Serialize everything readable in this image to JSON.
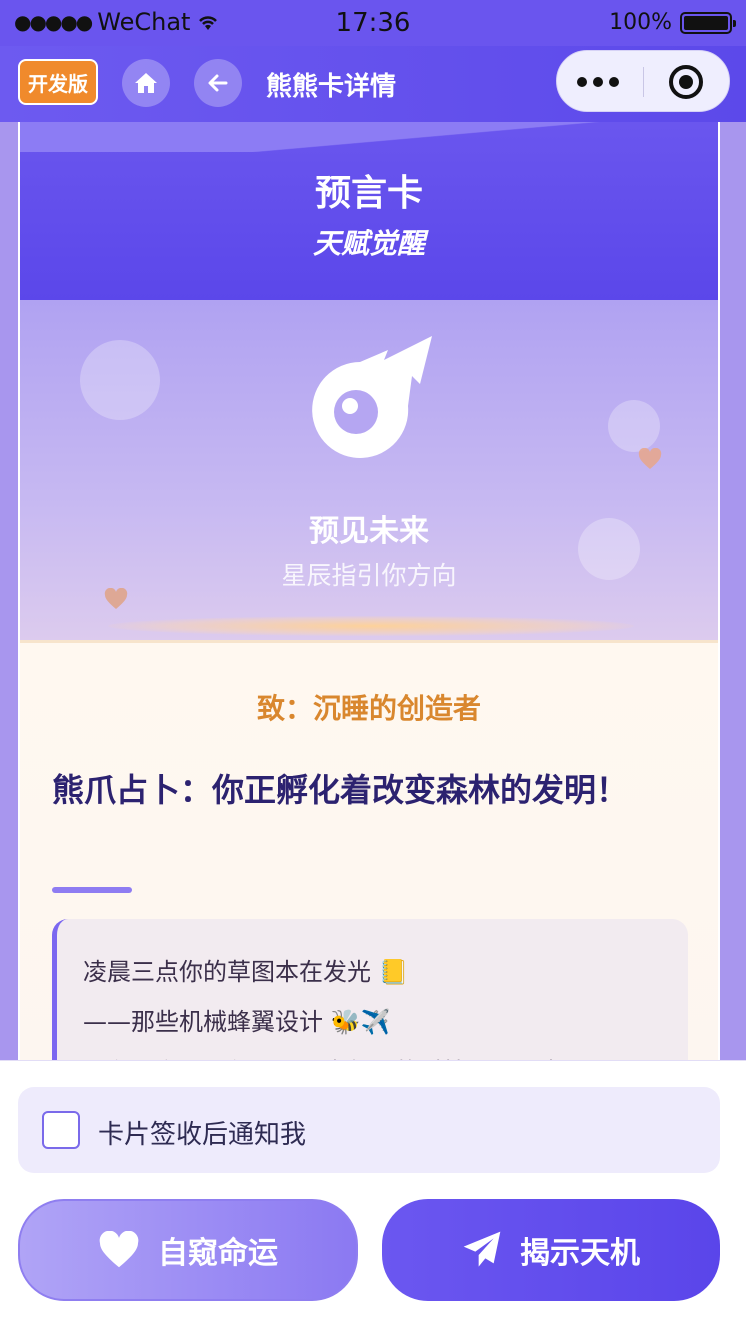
{
  "status_bar": {
    "carrier": "WeChat",
    "time": "17:36",
    "battery": "100%"
  },
  "nav": {
    "dev_badge": "开发版",
    "title": "熊熊卡详情",
    "icons": {
      "home": "home-icon",
      "back": "arrow-left-icon",
      "more": "more-dots-icon",
      "close": "target-close-icon"
    }
  },
  "card": {
    "title": "预言卡",
    "subtitle": "天赋觉醒",
    "hero": {
      "icon": "comet-icon",
      "title": "预见未来",
      "subtitle": "星辰指引你方向"
    },
    "letter": {
      "to": "致：沉睡的创造者",
      "headline": "熊爪占卜：你正孵化着改变森林的发明！",
      "body_lines": [
        "凌晨三点你的草图本在发光 📒",
        "——那些机械蜂翼设计 🐝✈️",
        "正在异次元进化！预见半年后的科技展上，当"
      ]
    }
  },
  "bottom": {
    "notify_label": "卡片签收后通知我",
    "notify_checked": false,
    "buttons": {
      "fate": "自窥命运",
      "reveal": "揭示天机"
    }
  },
  "colors": {
    "primary": "#5c49ea",
    "dev_badge": "#f08a2c",
    "accent_text": "#d9872e",
    "headline": "#2c2270"
  }
}
